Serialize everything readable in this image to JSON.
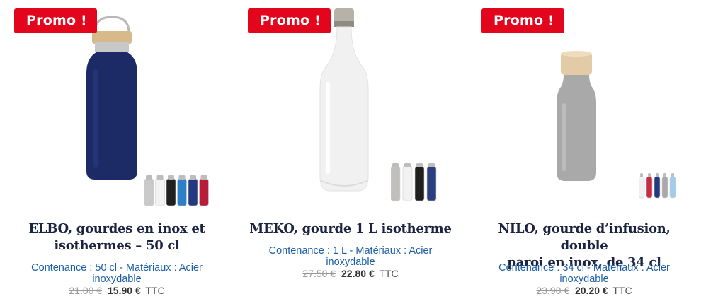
{
  "products": [
    {
      "badge": "Promo !",
      "title_line1": "ELBO, gourdes en inox et",
      "title_line2": "isothermes – 50 cl",
      "desc_line1": "Contenance : 50 cl - Matériaux : Acier",
      "desc_line2": "inoxydable",
      "old_price": "21.00 €",
      "new_price": "15.90 €",
      "tax": "TTC",
      "main_color": "#1c2a66",
      "variant_colors": [
        "#c9c9c9",
        "#f2f2f2",
        "#1f1f1f",
        "#2d7fc9",
        "#243a80",
        "#b71c3a"
      ]
    },
    {
      "badge": "Promo !",
      "title_line1": "MEKO, gourde 1 L isotherme",
      "title_line2": "",
      "desc_line1": "Contenance : 1 L - Matériaux : Acier",
      "desc_line2": "inoxydable",
      "old_price": "27.50 €",
      "new_price": "22.80 €",
      "tax": "TTC",
      "main_color": "#f1f1f1",
      "variant_colors": [
        "#c0bfbc",
        "#f2f2f2",
        "#1f1f1f",
        "#2b3f80"
      ]
    },
    {
      "badge": "Promo !",
      "title_line1": "NILO, gourde d’infusion, double",
      "title_line2": "paroi en inox, de 34 cl",
      "desc_line1": "Contenance : 34 cl - Matériaux : Acier",
      "desc_line2": "inoxydable",
      "old_price": "23.90 €",
      "new_price": "20.20 €",
      "tax": "TTC",
      "main_color": "#a9a9a9",
      "variant_colors": [
        "#f0f0f0",
        "#c92a45",
        "#243a80",
        "#a9a9a9",
        "#9fcdea"
      ]
    }
  ]
}
